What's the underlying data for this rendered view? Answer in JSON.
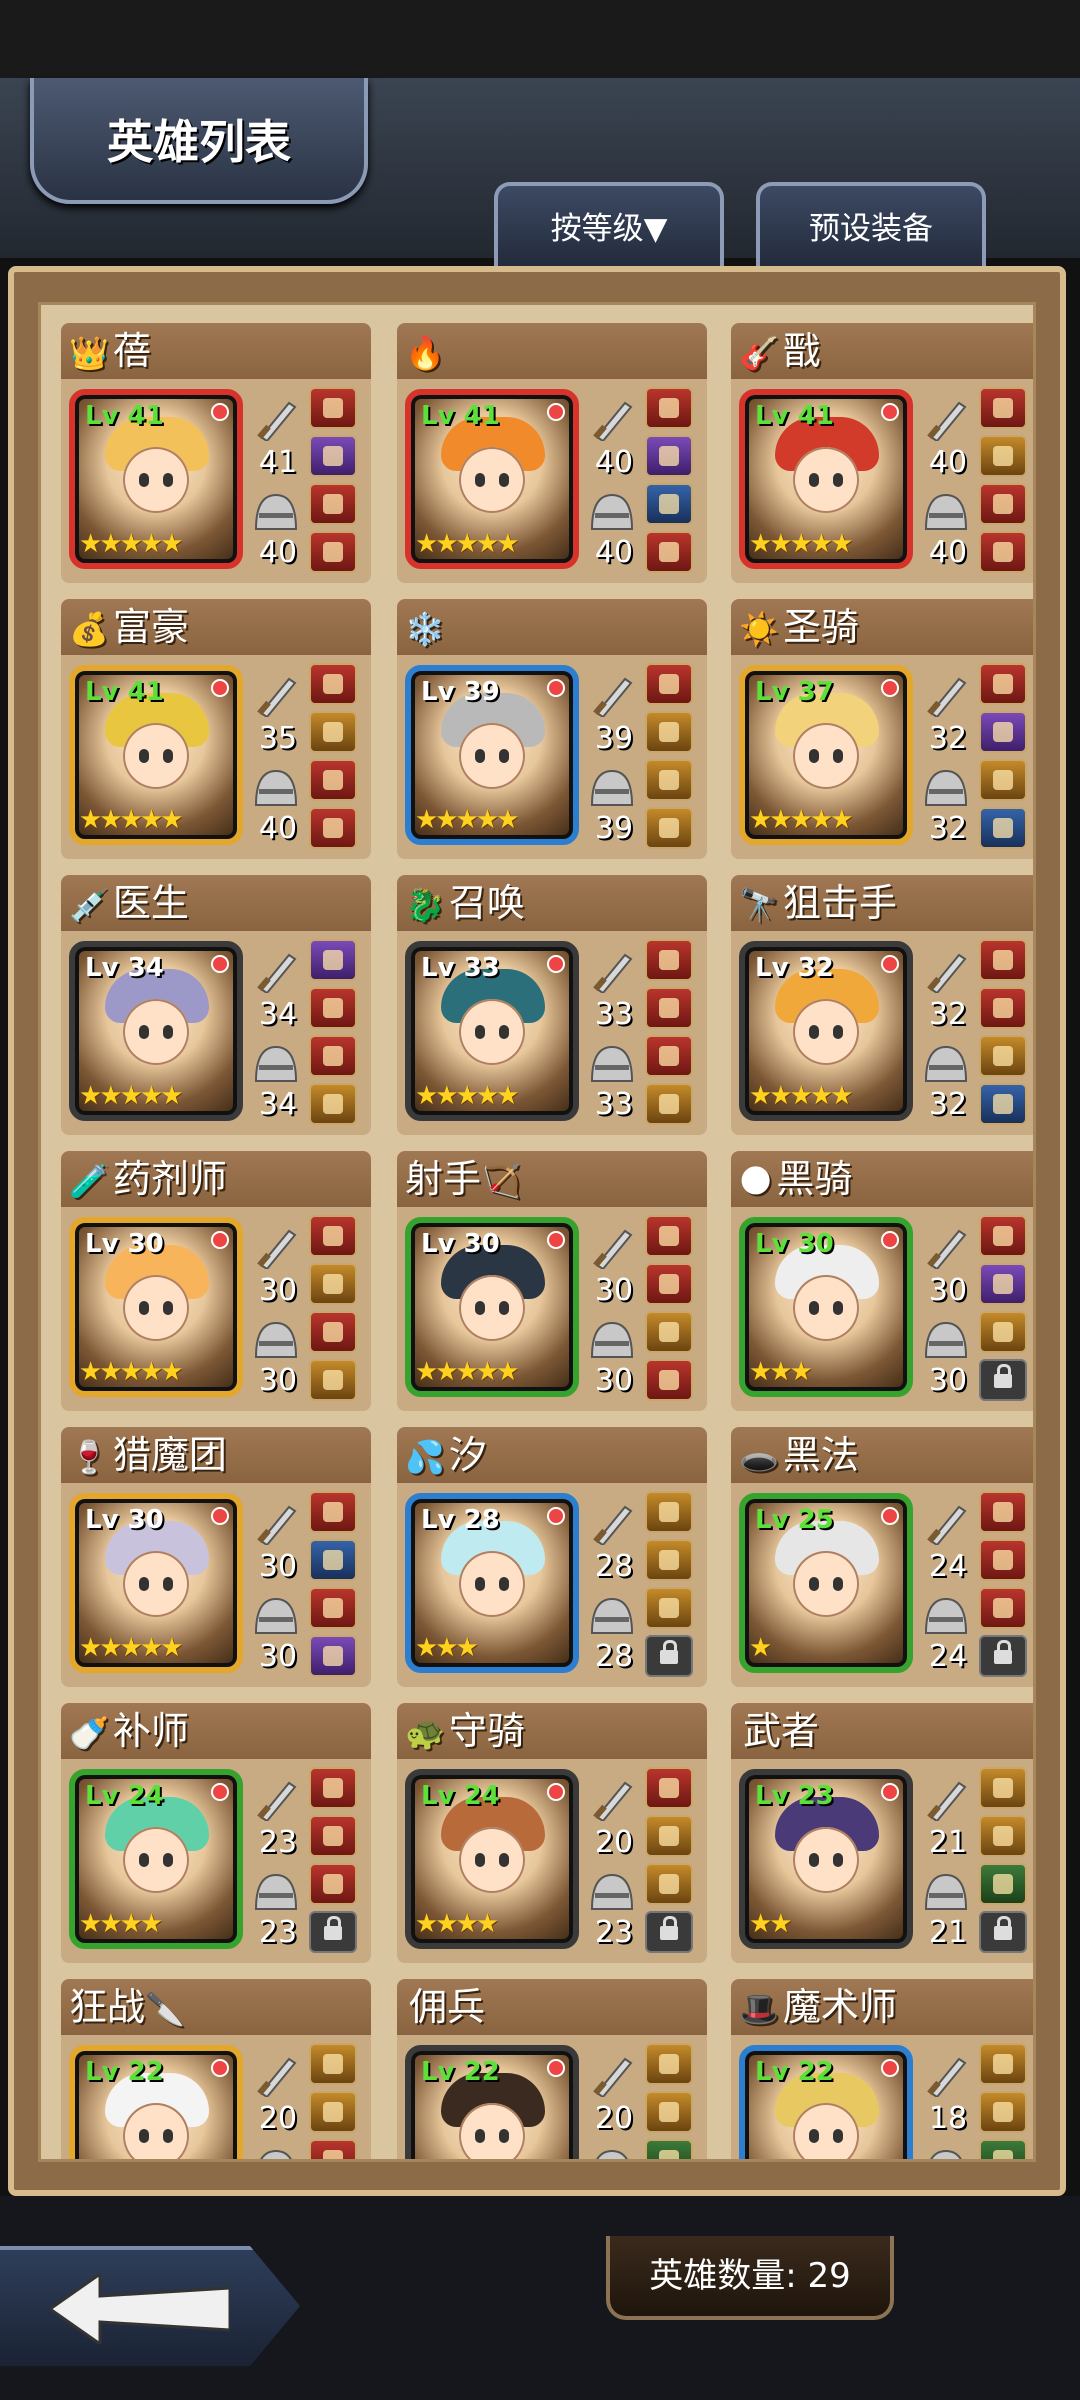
{
  "header": {
    "title": "英雄列表"
  },
  "tabs": [
    {
      "label": "按等级▼"
    },
    {
      "label": "预设装备"
    }
  ],
  "colors": {
    "frame_gold": "#e3a72c",
    "frame_red": "#d8332b",
    "frame_blue": "#2c7fd0",
    "frame_green": "#35a32d",
    "level_green": "#5de03a",
    "star": "#ffd21f"
  },
  "heroes": [
    {
      "emoji": "👑",
      "name": "蓓",
      "level": "Lv 41",
      "level_green": true,
      "stars": "★★★★★",
      "attack": "41",
      "defense": "40",
      "frame": "red",
      "slots": [
        "red",
        "purple",
        "red",
        "red"
      ]
    },
    {
      "emoji": "🔥",
      "name": "",
      "level": "Lv 41",
      "level_green": true,
      "stars": "★★★★★",
      "attack": "40",
      "defense": "40",
      "frame": "red",
      "slots": [
        "red",
        "purple",
        "blue",
        "red"
      ]
    },
    {
      "emoji": "🎸",
      "name": "戬",
      "level": "Lv 41",
      "level_green": true,
      "stars": "★★★★★",
      "attack": "40",
      "defense": "40",
      "frame": "red",
      "slots": [
        "red",
        "gold",
        "red",
        "red"
      ]
    },
    {
      "emoji": "💰",
      "name": "富豪",
      "level": "Lv 41",
      "level_green": true,
      "stars": "★★★★★",
      "attack": "35",
      "defense": "40",
      "frame": "gold",
      "slots": [
        "red",
        "gold",
        "red",
        "red"
      ]
    },
    {
      "emoji": "❄️",
      "name": "",
      "level": "Lv 39",
      "level_green": false,
      "stars": "★★★★★",
      "attack": "39",
      "defense": "39",
      "frame": "blue",
      "slots": [
        "red",
        "gold",
        "gold",
        "gold"
      ]
    },
    {
      "emoji": "☀️",
      "name": "圣骑",
      "level": "Lv 37",
      "level_green": true,
      "stars": "★★★★★",
      "attack": "32",
      "defense": "32",
      "frame": "gold",
      "slots": [
        "red",
        "purple",
        "gold",
        "blue"
      ]
    },
    {
      "emoji": "💉",
      "name": "医生",
      "level": "Lv 34",
      "level_green": false,
      "stars": "★★★★★",
      "attack": "34",
      "defense": "34",
      "frame": "dark",
      "slots": [
        "purple",
        "red",
        "red",
        "gold"
      ]
    },
    {
      "emoji": "🐉",
      "name": "召唤",
      "level": "Lv 33",
      "level_green": false,
      "stars": "★★★★★",
      "attack": "33",
      "defense": "33",
      "frame": "dark",
      "slots": [
        "red",
        "red",
        "red",
        "gold"
      ]
    },
    {
      "emoji": "🔭",
      "name": "狙击手",
      "level": "Lv 32",
      "level_green": false,
      "stars": "★★★★★",
      "attack": "32",
      "defense": "32",
      "frame": "dark",
      "slots": [
        "red",
        "red",
        "gold",
        "blue"
      ]
    },
    {
      "emoji": "🧪",
      "name": "药剂师",
      "level": "Lv 30",
      "level_green": false,
      "stars": "★★★★★",
      "attack": "30",
      "defense": "30",
      "frame": "gold",
      "slots": [
        "red",
        "gold",
        "red",
        "gold"
      ]
    },
    {
      "emoji": "🏹",
      "name": "射手",
      "emoji_after": true,
      "level": "Lv 30",
      "level_green": false,
      "stars": "★★★★★",
      "attack": "30",
      "defense": "30",
      "frame": "green",
      "slots": [
        "red",
        "red",
        "gold",
        "red"
      ]
    },
    {
      "emoji": "🌑",
      "name": "黑骑",
      "level": "Lv 30",
      "level_green": true,
      "stars": "★★★",
      "attack": "30",
      "defense": "30",
      "frame": "green",
      "slots": [
        "red",
        "purple",
        "gold",
        "lock"
      ]
    },
    {
      "emoji": "🍷",
      "name": "猎魔团",
      "level": "Lv 30",
      "level_green": false,
      "stars": "★★★★★",
      "attack": "30",
      "defense": "30",
      "frame": "gold",
      "slots": [
        "red",
        "blue",
        "red",
        "purple"
      ]
    },
    {
      "emoji": "💦",
      "name": "汐",
      "level": "Lv 28",
      "level_green": false,
      "stars": "★★★",
      "attack": "28",
      "defense": "28",
      "frame": "blue",
      "slots": [
        "gold",
        "gold",
        "gold",
        "lock"
      ]
    },
    {
      "emoji": "🕳️",
      "name": "黑法",
      "level": "Lv 25",
      "level_green": true,
      "stars": "★",
      "attack": "24",
      "defense": "24",
      "frame": "green",
      "slots": [
        "red",
        "red",
        "red",
        "lock"
      ]
    },
    {
      "emoji": "🍼",
      "name": "补师",
      "level": "Lv 24",
      "level_green": true,
      "stars": "★★★★",
      "attack": "23",
      "defense": "23",
      "frame": "green",
      "slots": [
        "red",
        "red",
        "red",
        "lock"
      ]
    },
    {
      "emoji": "🐢",
      "name": "守骑",
      "level": "Lv 24",
      "level_green": true,
      "stars": "★★★★",
      "attack": "20",
      "defense": "23",
      "frame": "dark",
      "slots": [
        "red",
        "gold",
        "gold",
        "lock"
      ]
    },
    {
      "emoji": "",
      "name": "武者",
      "level": "Lv 23",
      "level_green": true,
      "stars": "★★",
      "attack": "21",
      "defense": "21",
      "frame": "dark",
      "slots": [
        "gold",
        "gold",
        "green",
        "lock"
      ]
    },
    {
      "emoji": "🔪",
      "name": "狂战",
      "emoji_after": true,
      "level": "Lv 22",
      "level_green": true,
      "stars": "",
      "attack": "20",
      "defense": "",
      "frame": "gold",
      "slots": [
        "gold",
        "gold",
        "red",
        "red"
      ]
    },
    {
      "emoji": "",
      "name": "佣兵",
      "level": "Lv 22",
      "level_green": true,
      "stars": "",
      "attack": "20",
      "defense": "",
      "frame": "dark",
      "slots": [
        "gold",
        "gold",
        "green",
        "green"
      ]
    },
    {
      "emoji": "🎩",
      "name": "魔术师",
      "level": "Lv 22",
      "level_green": true,
      "stars": "",
      "attack": "18",
      "defense": "",
      "frame": "blue",
      "slots": [
        "gold",
        "gold",
        "green",
        "green"
      ]
    }
  ],
  "footer": {
    "hero_count": "英雄数量: 29"
  }
}
